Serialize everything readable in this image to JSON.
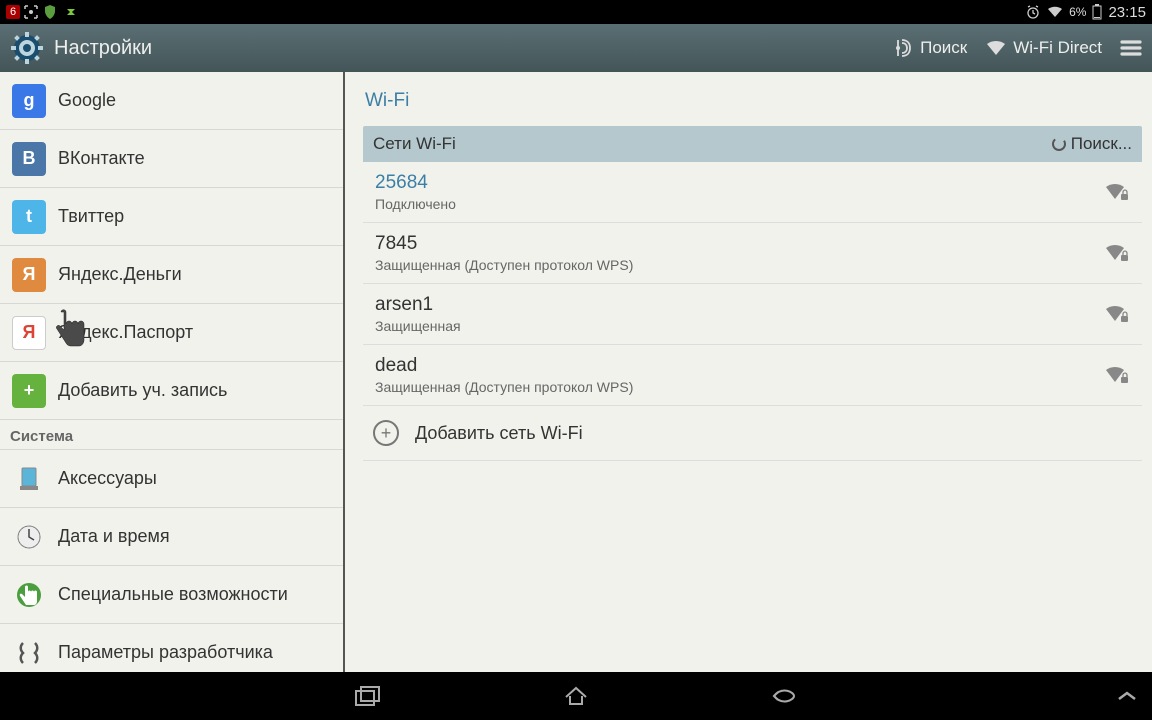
{
  "status_bar": {
    "notif_count": "6",
    "battery_pct": "6%",
    "time": "23:15"
  },
  "titlebar": {
    "title": "Настройки",
    "search": "Поиск",
    "wifi_direct": "Wi-Fi Direct"
  },
  "sidebar": {
    "items": [
      {
        "label": "Google",
        "icon_bg": "#3b78e7",
        "icon_text": "g"
      },
      {
        "label": "ВКонтакте",
        "icon_bg": "#4a76a8",
        "icon_text": "B"
      },
      {
        "label": "Твиттер",
        "icon_bg": "#4db5e8",
        "icon_text": "t"
      },
      {
        "label": "Яндекс.Деньги",
        "icon_bg": "#e08a3f",
        "icon_text": "Я"
      },
      {
        "label": "Яндекс.Паспорт",
        "icon_bg": "#fff",
        "icon_text": "Я",
        "icon_color": "#d43"
      },
      {
        "label": "Добавить уч. запись",
        "icon_bg": "#66b23e",
        "icon_text": "+"
      }
    ],
    "section": "Система",
    "system_items": [
      {
        "label": "Аксессуары"
      },
      {
        "label": "Дата и время"
      },
      {
        "label": "Специальные возможности"
      },
      {
        "label": "Параметры разработчика"
      }
    ]
  },
  "main": {
    "title": "Wi-Fi",
    "header_label": "Сети Wi-Fi",
    "scanning": "Поиск...",
    "networks": [
      {
        "name": "25684",
        "status": "Подключено",
        "connected": true
      },
      {
        "name": "7845",
        "status": "Защищенная (Доступен протокол WPS)",
        "connected": false
      },
      {
        "name": "arsen1",
        "status": "Защищенная",
        "connected": false
      },
      {
        "name": "dead",
        "status": "Защищенная (Доступен протокол WPS)",
        "connected": false
      }
    ],
    "add_network": "Добавить сеть Wi-Fi"
  }
}
